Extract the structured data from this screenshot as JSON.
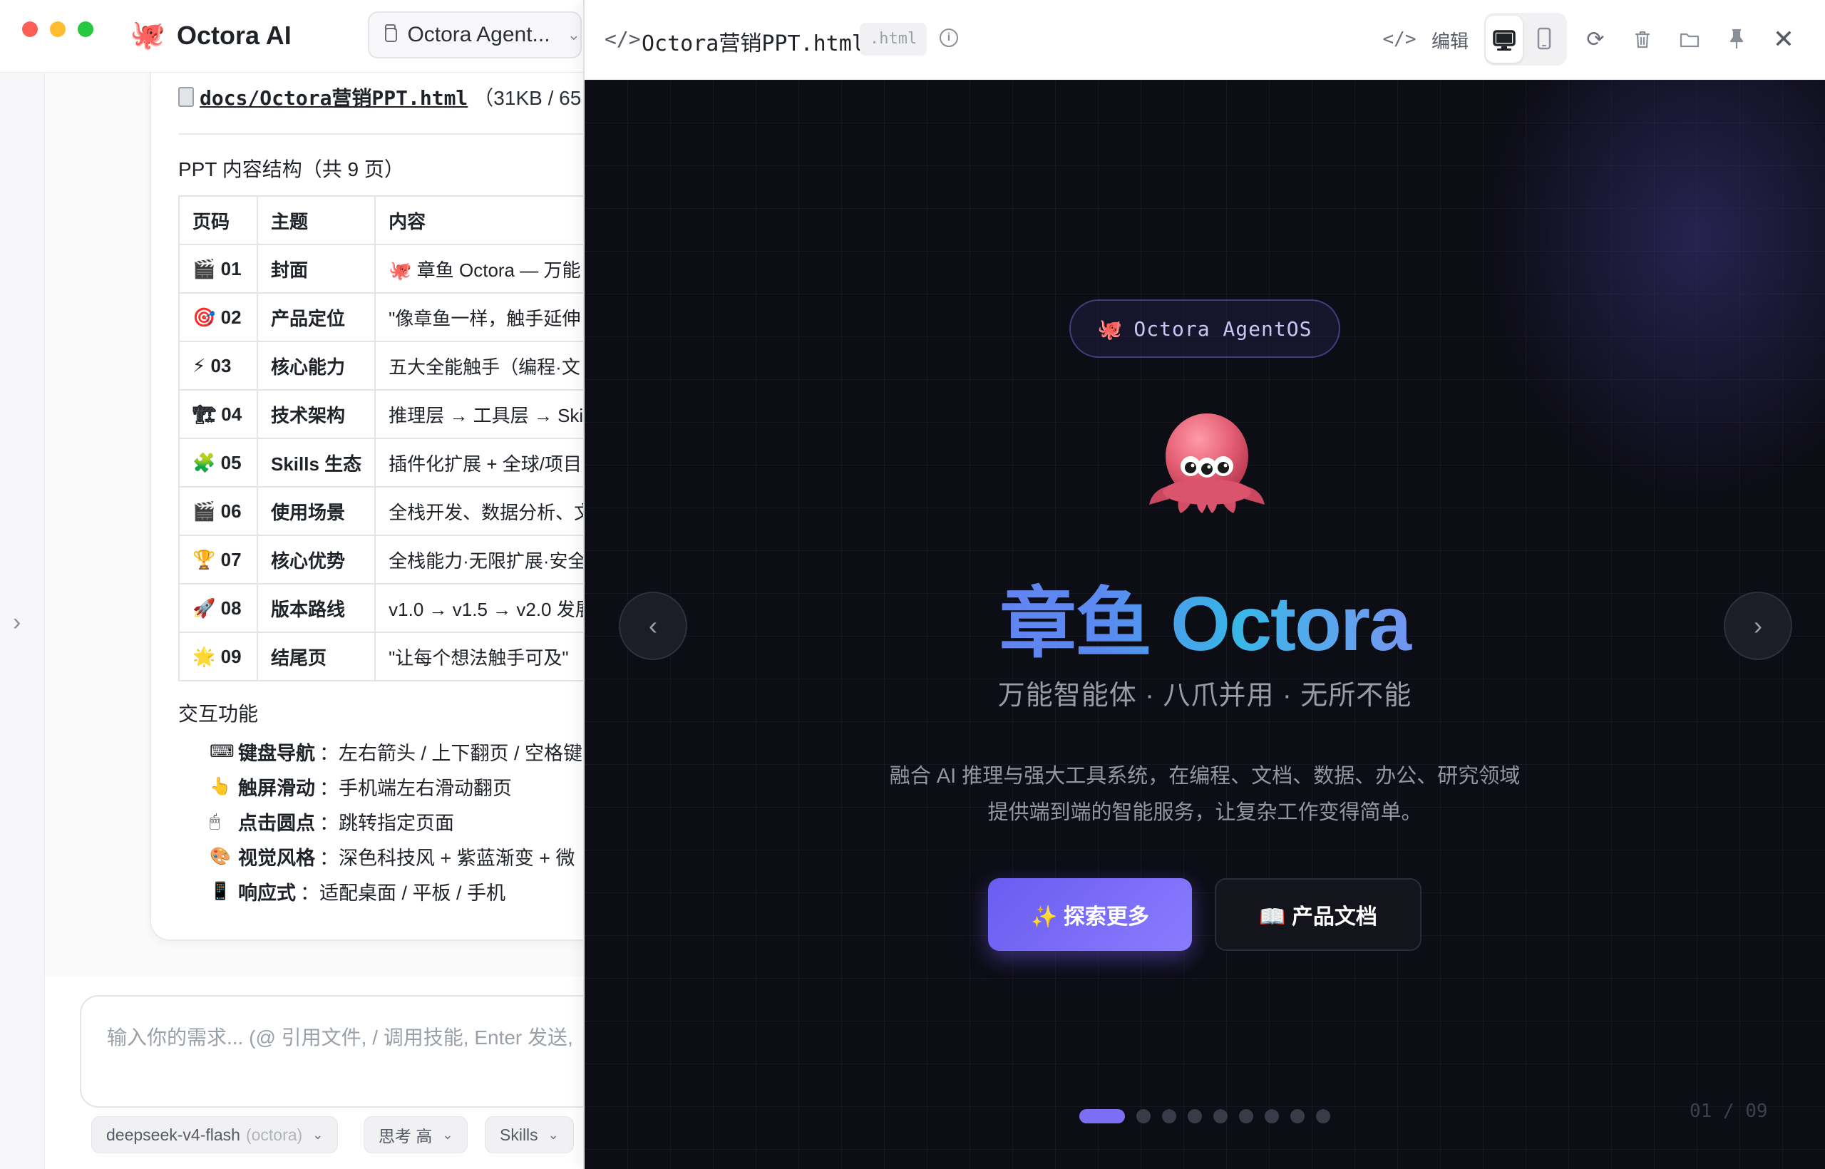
{
  "app": {
    "logo_emoji": "🐙",
    "name": "Octora AI",
    "agent_select": "Octora Agent...",
    "sidebar_toggle": "›"
  },
  "message": {
    "file_name": "docs/Octora营销PPT.html",
    "file_meta": "（31KB / 65",
    "structure_title": "PPT 内容结构（共 9 页）",
    "table_headers": [
      "页码",
      "主题",
      "内容"
    ],
    "rows": [
      {
        "icon": "🎬",
        "page": "01",
        "topic": "封面",
        "content": "🐙 章鱼 Octora — 万能"
      },
      {
        "icon": "🎯",
        "page": "02",
        "topic": "产品定位",
        "content": "\"像章鱼一样，触手延伸"
      },
      {
        "icon": "⚡",
        "page": "03",
        "topic": "核心能力",
        "content": "五大全能触手（编程·文"
      },
      {
        "icon": "🏗",
        "page": "04",
        "topic": "技术架构",
        "content": "推理层 → 工具层 → Ski"
      },
      {
        "icon": "🧩",
        "page": "05",
        "topic": "Skills 生态",
        "content": "插件化扩展 + 全球/项目"
      },
      {
        "icon": "🎬",
        "page": "06",
        "topic": "使用场景",
        "content": "全栈开发、数据分析、文"
      },
      {
        "icon": "🏆",
        "page": "07",
        "topic": "核心优势",
        "content": "全栈能力·无限扩展·安全"
      },
      {
        "icon": "🚀",
        "page": "08",
        "topic": "版本路线",
        "content": "v1.0 → v1.5 → v2.0 发展"
      },
      {
        "icon": "🌟",
        "page": "09",
        "topic": "结尾页",
        "content": "\"让每个想法触手可及\""
      }
    ],
    "interaction_title": "交互功能",
    "features": [
      {
        "icon": "⌨",
        "label": "键盘导航",
        "text": "：左右箭头 / 上下翻页 / 空格键"
      },
      {
        "icon": "👆",
        "label": "触屏滑动",
        "text": "：手机端左右滑动翻页"
      },
      {
        "icon": "🖱",
        "label": "点击圆点",
        "text": "：跳转指定页面"
      },
      {
        "icon": "🎨",
        "label": "视觉风格",
        "text": "：深色科技风 + 紫蓝渐变 + 微"
      },
      {
        "icon": "📱",
        "label": "响应式",
        "text": "：适配桌面 / 平板 / 手机"
      }
    ]
  },
  "composer": {
    "placeholder": "输入你的需求... (@ 引用文件, / 调用技能, Enter 发送,",
    "model": "deepseek-v4-flash",
    "model_provider": "(octora)",
    "thinking": "思考 高",
    "skills": "Skills"
  },
  "preview": {
    "title": "Octora营销PPT.html",
    "ext": ".html",
    "edit_label": "编辑",
    "slide": {
      "badge": "Octora AgentOS",
      "badge_emoji": "🐙",
      "title": "章鱼 Octora",
      "subtitle": "万能智能体 · 八爪并用 · 无所不能",
      "desc_line1": "融合 AI 推理与强大工具系统，在编程、文档、数据、办公、研究领域",
      "desc_line2": "提供端到端的智能服务，让复杂工作变得简单。",
      "primary_cta": "✨ 探索更多",
      "secondary_cta": "📖 产品文档",
      "prev": "‹",
      "next": "›",
      "page_counter": "01 / 09",
      "total_pages": 9,
      "current_page": 1
    },
    "colors": {
      "accent": "#7c6ff5",
      "stage_bg": "#0d0d16"
    }
  }
}
